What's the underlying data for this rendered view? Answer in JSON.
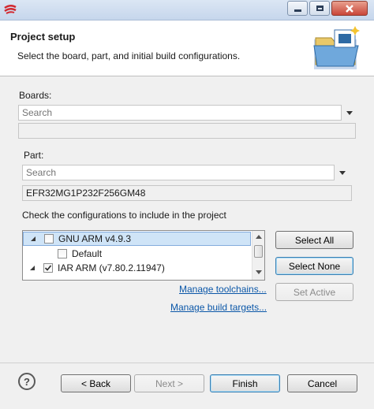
{
  "window": {
    "minimize_icon": "minimize-icon",
    "maximize_icon": "maximize-icon",
    "close_icon": "close-icon"
  },
  "header": {
    "title": "Project setup",
    "description": "Select the board, part, and initial build configurations."
  },
  "boards": {
    "label": "Boards:",
    "search_placeholder": "Search"
  },
  "part": {
    "label": "Part:",
    "search_placeholder": "Search",
    "selected": "EFR32MG1P232F256GM48"
  },
  "configurations": {
    "label": "Check the configurations to include in the project",
    "items": [
      {
        "label": "GNU ARM v4.9.3",
        "checked": false
      },
      {
        "label": "Default",
        "checked": false
      },
      {
        "label": "IAR ARM (v7.80.2.11947)",
        "checked": true
      }
    ],
    "select_all": "Select All",
    "select_none": "Select None",
    "set_active": "Set Active",
    "manage_toolchains": "Manage toolchains...",
    "manage_build_targets": "Manage build targets..."
  },
  "footer": {
    "help": "?",
    "back": "< Back",
    "next": "Next >",
    "finish": "Finish",
    "cancel": "Cancel"
  },
  "colors": {
    "accent": "#3c7fb1",
    "link": "#0b57a8",
    "selection": "#cfe4f7"
  }
}
